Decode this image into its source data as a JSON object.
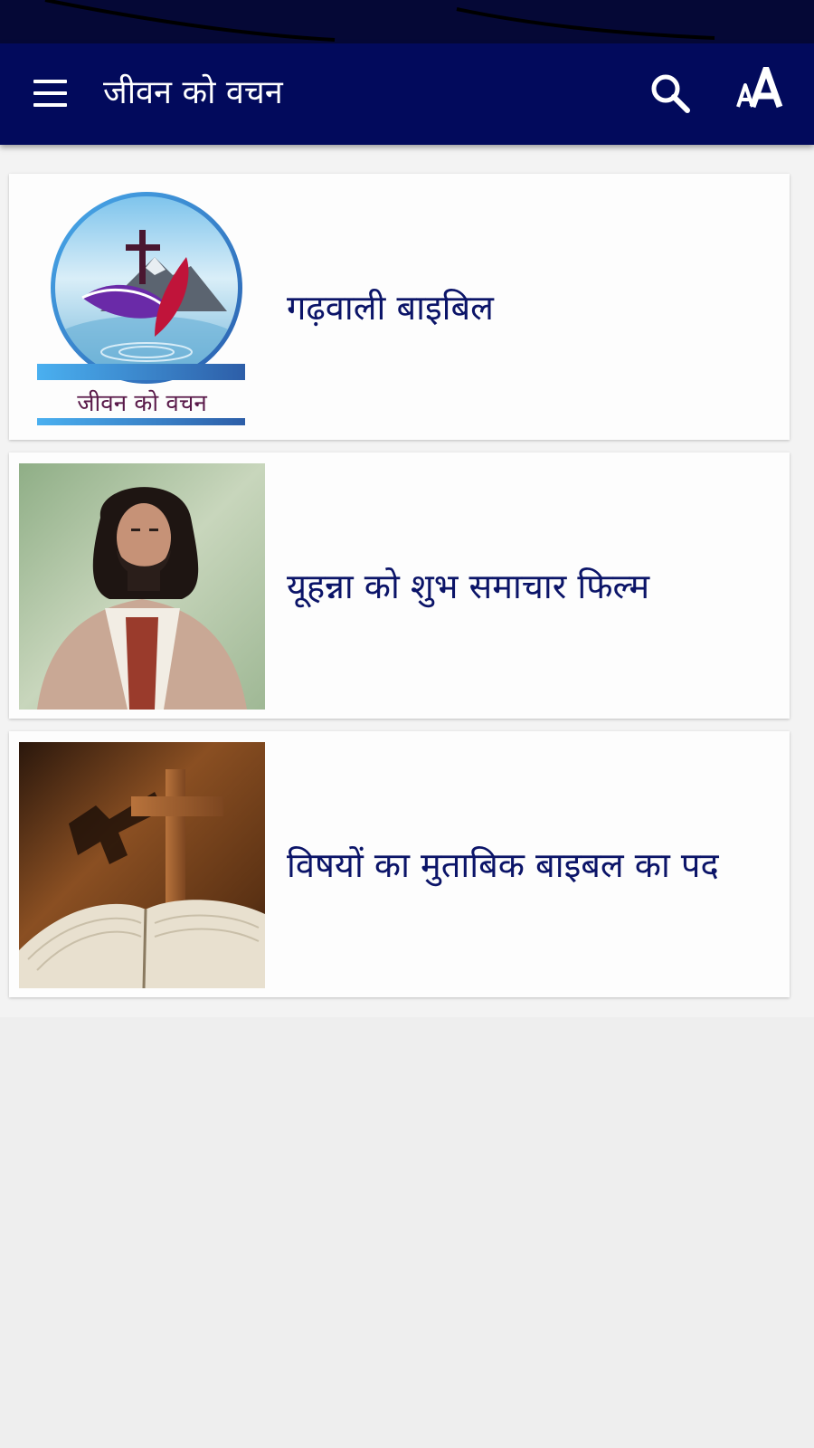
{
  "app": {
    "title": "जीवन को वचन"
  },
  "toolbar": {
    "menu_icon": "hamburger-menu-icon",
    "search_icon": "search-icon",
    "font_size_icon": "font-size-icon"
  },
  "items": [
    {
      "label": "गढ़वाली बाइबिल",
      "thumb": "jeevan-ko-vachan-logo",
      "logo_caption": "जीवन को वचन"
    },
    {
      "label": "यूहन्ना को शुभ समाचार फिल्म",
      "thumb": "jesus-portrait-photo"
    },
    {
      "label": "विषयों का मुताबिक बाइबल का पद",
      "thumb": "cross-and-bible-photo"
    }
  ],
  "colors": {
    "app_bar": "#020a5c",
    "status_bar": "#050836",
    "label_text": "#0b1468",
    "background": "#eeeeee"
  }
}
